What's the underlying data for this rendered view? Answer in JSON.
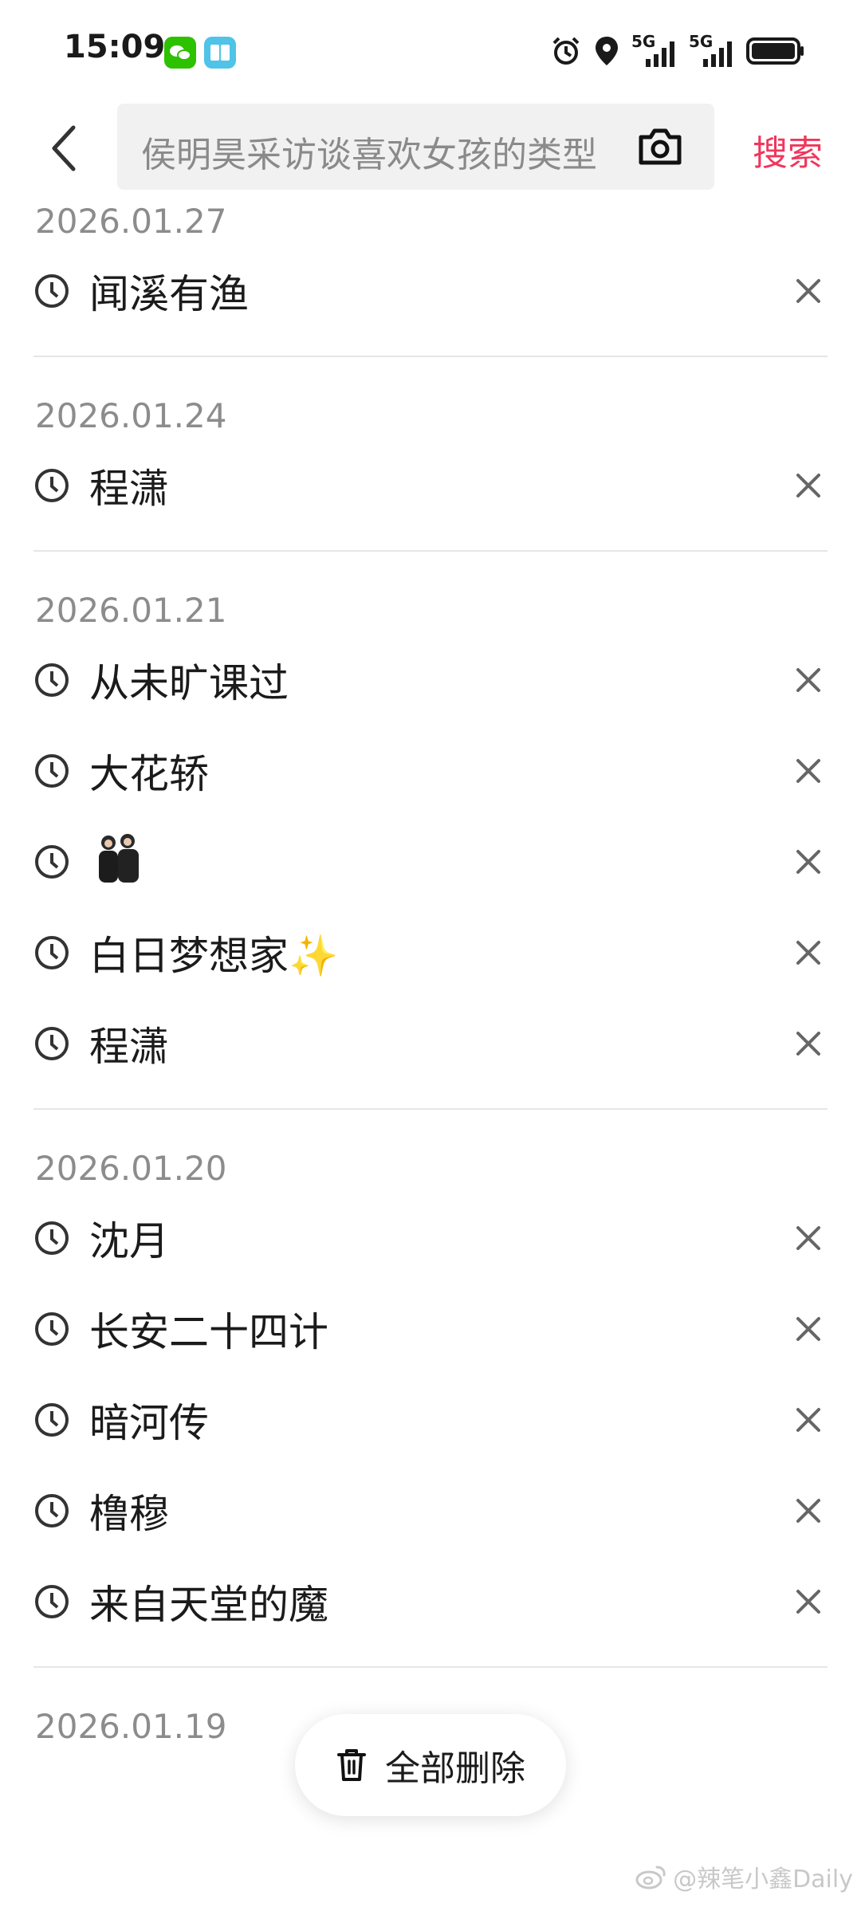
{
  "status_bar": {
    "time": "15:09",
    "network_1": "5G",
    "network_2": "5G"
  },
  "search": {
    "placeholder": "侯明昊采访谈喜欢女孩的类型",
    "search_label": "搜索"
  },
  "groups": [
    {
      "date": "2026.01.27",
      "items": [
        "闻溪有渔"
      ]
    },
    {
      "date": "2026.01.24",
      "items": [
        "程潇"
      ]
    },
    {
      "date": "2026.01.21",
      "items": [
        "从未旷课过",
        "大花轿",
        "",
        "白日梦想家✨",
        "程潇"
      ]
    },
    {
      "date": "2026.01.20",
      "items": [
        "沈月",
        "长安二十四计",
        "暗河传",
        "橹穆",
        "来自天堂的魔"
      ]
    },
    {
      "date": "2026.01.19",
      "items": []
    }
  ],
  "delete_all_label": "全部删除",
  "watermark": "@辣笔小鑫Daily",
  "colors": {
    "accent": "#f0365c",
    "text_primary": "#1b1b1b",
    "text_secondary": "#8c8c8c"
  }
}
